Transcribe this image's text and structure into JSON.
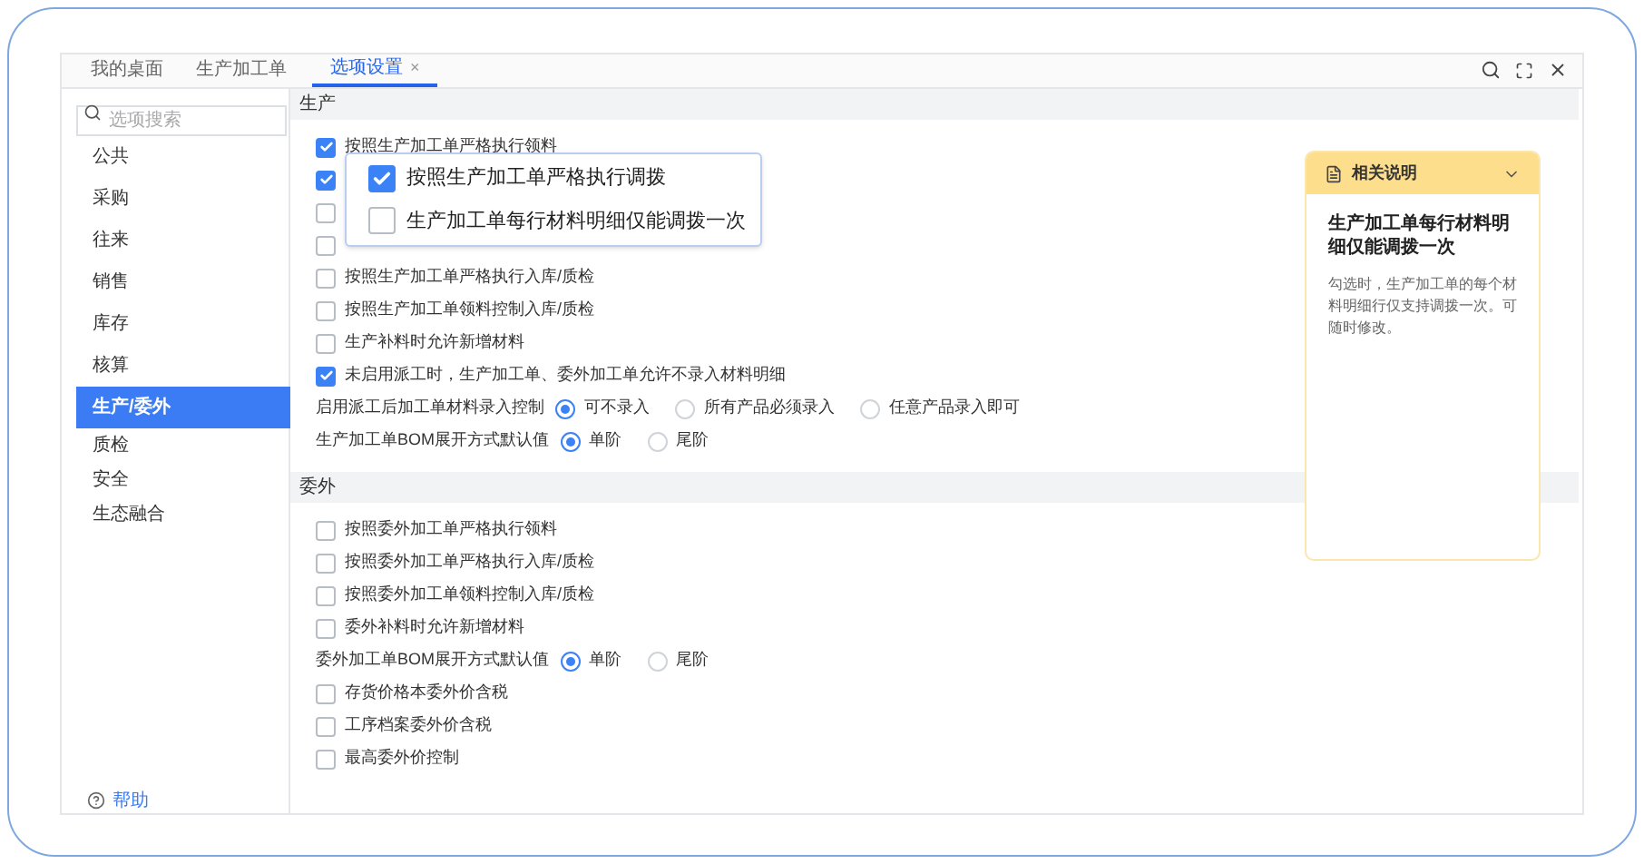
{
  "tabs": [
    {
      "label": "我的桌面",
      "selected": false,
      "closable": false
    },
    {
      "label": "生产加工单",
      "selected": false,
      "closable": false
    },
    {
      "label": "选项设置",
      "selected": true,
      "closable": true
    }
  ],
  "close_glyph": "×",
  "sidebar": {
    "search": {
      "placeholder": "选项搜索"
    },
    "items": [
      {
        "label": "公共",
        "selected": false
      },
      {
        "label": "采购",
        "selected": false
      },
      {
        "label": "往来",
        "selected": false
      },
      {
        "label": "销售",
        "selected": false
      },
      {
        "label": "库存",
        "selected": false
      },
      {
        "label": "核算",
        "selected": false
      },
      {
        "label": "生产/委外",
        "selected": true
      },
      {
        "label": "质检",
        "selected": false
      },
      {
        "label": "安全",
        "selected": false
      },
      {
        "label": "生态融合",
        "selected": false
      }
    ],
    "help": "帮助"
  },
  "sections": [
    {
      "title": "生产",
      "rows": [
        {
          "kind": "checkbox",
          "label": "按照生产加工单严格执行领料",
          "checked": true
        },
        {
          "kind": "checkbox",
          "checked": true
        },
        {
          "kind": "checkbox",
          "checked": false
        },
        {
          "kind": "checkbox",
          "checked": false
        },
        {
          "kind": "checkbox",
          "label": "按照生产加工单严格执行入库/质检",
          "checked": false
        },
        {
          "kind": "checkbox",
          "label": "按照生产加工单领料控制入库/质检",
          "checked": false
        },
        {
          "kind": "checkbox",
          "label": "生产补料时允许新增材料",
          "checked": false
        },
        {
          "kind": "checkbox",
          "label": "未启用派工时，生产加工单、委外加工单允许不录入材料明细",
          "checked": true
        },
        {
          "kind": "radio",
          "label": "启用派工后加工单材料录入控制",
          "options": [
            {
              "label": "可不录入",
              "selected": true
            },
            {
              "label": "所有产品必须录入",
              "selected": false
            },
            {
              "label": "任意产品录入即可",
              "selected": false
            }
          ]
        },
        {
          "kind": "radio",
          "label": "生产加工单BOM展开方式默认值",
          "options": [
            {
              "label": "单阶",
              "selected": true
            },
            {
              "label": "尾阶",
              "selected": false
            }
          ]
        }
      ]
    },
    {
      "title": "委外",
      "rows": [
        {
          "kind": "checkbox",
          "label": "按照委外加工单严格执行领料",
          "checked": false
        },
        {
          "kind": "checkbox",
          "label": "按照委外加工单严格执行入库/质检",
          "checked": false
        },
        {
          "kind": "checkbox",
          "label": "按照委外加工单领料控制入库/质检",
          "checked": false
        },
        {
          "kind": "checkbox",
          "label": "委外补料时允许新增材料",
          "checked": false
        },
        {
          "kind": "radio",
          "label": "委外加工单BOM展开方式默认值",
          "options": [
            {
              "label": "单阶",
              "selected": true
            },
            {
              "label": "尾阶",
              "selected": false
            }
          ]
        },
        {
          "kind": "checkbox",
          "label": "存货价格本委外价含税",
          "checked": false
        },
        {
          "kind": "checkbox",
          "label": "工序档案委外价含税",
          "checked": false
        },
        {
          "kind": "checkbox",
          "label": "最高委外价控制",
          "checked": false
        }
      ]
    }
  ],
  "popup": {
    "items": [
      {
        "label": "按照生产加工单严格执行调拨",
        "checked": true
      },
      {
        "label": "生产加工单每行材料明细仅能调拨一次",
        "checked": false
      }
    ]
  },
  "help_panel": {
    "title": "相关说明",
    "heading": "生产加工单每行材料明细仅能调拨一次",
    "body": "勾选时，生产加工单的每个材料明细行仅支持调拨一次。可随时修改。"
  }
}
